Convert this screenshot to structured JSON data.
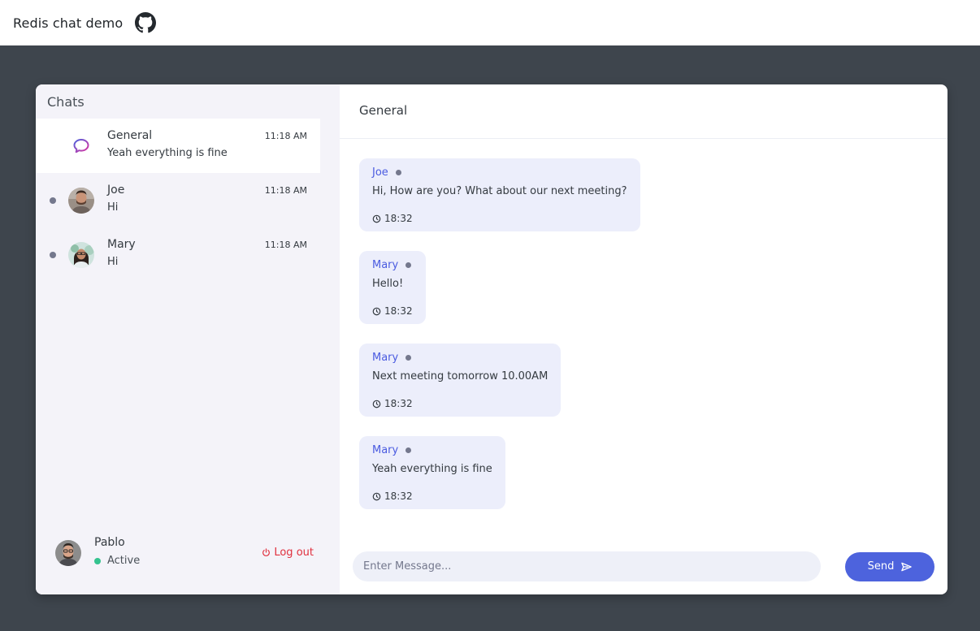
{
  "app": {
    "title": "Redis chat demo"
  },
  "sidebar": {
    "header": "Chats",
    "chats": [
      {
        "name": "General",
        "preview": "Yeah everything is fine",
        "time": "11:18 AM",
        "icon": "chat-bubble-icon"
      },
      {
        "name": "Joe",
        "preview": "Hi",
        "time": "11:18 AM",
        "icon": "avatar"
      },
      {
        "name": "Mary",
        "preview": "Hi",
        "time": "11:18 AM",
        "icon": "avatar"
      }
    ],
    "current_user": {
      "name": "Pablo",
      "status": "Active",
      "logout_label": "Log out"
    }
  },
  "main": {
    "title": "General",
    "messages": [
      {
        "from": "Joe",
        "text": "Hi, How are you? What about our next meeting?",
        "time": "18:32"
      },
      {
        "from": "Mary",
        "text": "Hello!",
        "time": "18:32"
      },
      {
        "from": "Mary",
        "text": "Next meeting tomorrow 10.00AM",
        "time": "18:32"
      },
      {
        "from": "Mary",
        "text": "Yeah everything is fine",
        "time": "18:32"
      }
    ],
    "composer": {
      "placeholder": "Enter Message...",
      "send_label": "Send"
    }
  },
  "colors": {
    "accent": "#4d63dd",
    "sender": "#4a5be0",
    "logout": "#e0303e",
    "active": "#34c38f"
  }
}
